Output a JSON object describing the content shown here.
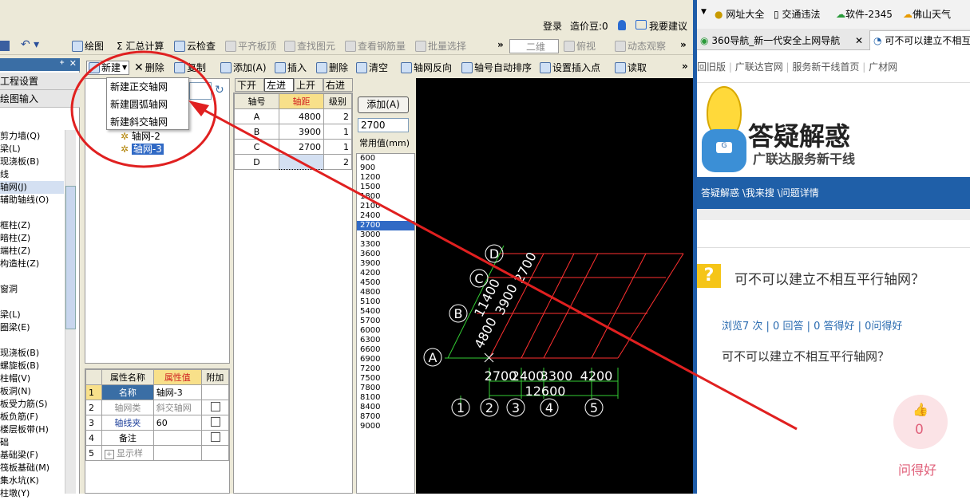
{
  "topbar": {
    "login": "登录",
    "price_label": "造价豆:0",
    "suggest": "我要建议"
  },
  "toolbar1": {
    "draw": "绘图",
    "sum": "Σ 汇总计算",
    "cloud": "云检查",
    "flat": "平齐板顶",
    "find": "查找图元",
    "view_rebar": "查看钢筋量",
    "batch": "批量选择",
    "more": "»",
    "view_mode": "二维",
    "look": "俯视",
    "dynamic": "动态观察"
  },
  "toolbar2": {
    "new": "新建",
    "delete": "删除",
    "copy": "复制",
    "add": "添加(A)",
    "insert": "插入",
    "delete2": "删除",
    "clear": "清空",
    "reverse": "轴网反向",
    "auto_sort": "轴号自动排序",
    "set_insert": "设置插入点",
    "read": "读取"
  },
  "new_menu": [
    "新建正交轴网",
    "新建圆弧轴网",
    "新建斜交轴网"
  ],
  "tree": [
    "轴网-2",
    "轴网-3"
  ],
  "left_panel": {
    "title1": "工程设置",
    "title2": "绘图输入",
    "items": [
      "剪力墙(Q)",
      "梁(L)",
      "现浇板(B)",
      "线",
      "轴网(J)",
      "辅助轴线(O)",
      "",
      "框柱(Z)",
      "暗柱(Z)",
      "端柱(Z)",
      "构造柱(Z)",
      "",
      "窗洞",
      "",
      "梁(L)",
      "圈梁(E)",
      "",
      "现浇板(B)",
      "螺旋板(B)",
      "柱帽(V)",
      "板洞(N)",
      "板受力筋(S)",
      "板负筋(F)",
      "楼层板带(H)",
      "础",
      "基础梁(F)",
      "筏板基础(M)",
      "集水坑(K)",
      "柱墩(Y)"
    ]
  },
  "axis_tabs": [
    "下开间",
    "左进深",
    "上开间",
    "右进深"
  ],
  "axis_table": {
    "headers": [
      "轴号",
      "轴距",
      "级别"
    ],
    "rows": [
      [
        "A",
        "4800",
        "2"
      ],
      [
        "B",
        "3900",
        "1"
      ],
      [
        "C",
        "2700",
        "1"
      ],
      [
        "D",
        "",
        "2"
      ]
    ]
  },
  "add_panel": {
    "add_button": "添加(A)",
    "value": "2700",
    "common_label": "常用值(mm)",
    "values": [
      "600",
      "900",
      "1200",
      "1500",
      "1800",
      "2100",
      "2400",
      "2700",
      "3000",
      "3300",
      "3600",
      "3900",
      "4200",
      "4500",
      "4800",
      "5100",
      "5400",
      "5700",
      "6000",
      "6300",
      "6600",
      "6900",
      "7200",
      "7500",
      "7800",
      "8100",
      "8400",
      "8700",
      "9000"
    ],
    "selected": "2700"
  },
  "props": {
    "headers": [
      "属性名称",
      "属性值",
      "附加"
    ],
    "rows": [
      [
        "1",
        "名称",
        "轴网-3"
      ],
      [
        "2",
        "轴网类",
        "斜交轴网"
      ],
      [
        "3",
        "轴线夹",
        "60"
      ],
      [
        "4",
        "备注",
        ""
      ],
      [
        "5",
        "显示样",
        ""
      ]
    ]
  },
  "cad": {
    "row_labels": [
      "D",
      "C",
      "B",
      "A"
    ],
    "col_labels": [
      "1",
      "2",
      "3",
      "4",
      "5"
    ],
    "dims_left": [
      "2700",
      "3900",
      "11400",
      "4800"
    ],
    "dims_bottom": [
      "2700",
      "2400",
      "3300",
      "4200"
    ],
    "total_bottom": "12600"
  },
  "browser": {
    "bookmarks": [
      "网址大全",
      "交通违法",
      "软件-2345",
      "佛山天气"
    ],
    "tabs": [
      "360导航_新一代安全上网导航",
      "可不可以建立不相互"
    ],
    "nav": [
      "回旧版",
      "广联达官网",
      "服务新干线首页",
      "广材网"
    ],
    "logo_title": "答疑解惑",
    "logo_sub": "广联达服务新干线",
    "breadcrumb": "答疑解惑 \\我来搜 \\问题详情",
    "question_title": "可不可以建立不相互平行轴网？",
    "stats": "浏览7 次 | 0 回答 | 0 答得好 | 0问得好",
    "question_body": "可不可以建立不相互平行轴网？",
    "like_count": "0",
    "like_label": "问得好"
  },
  "colors": {
    "cad_bg": "#000000",
    "axis_red": "#ff3030",
    "axis_green": "#33cc33",
    "annot_red": "#e02020",
    "header_yellow": "#f8e08a",
    "browser_blue": "#1f5fa8"
  }
}
